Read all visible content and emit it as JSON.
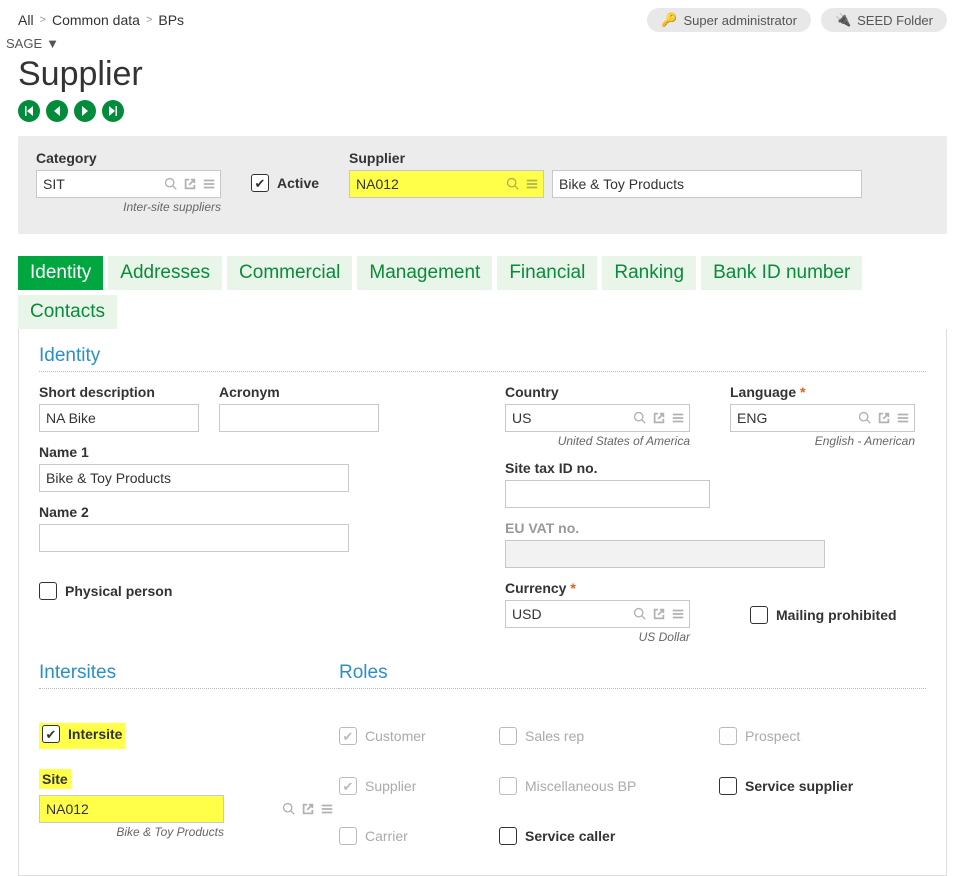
{
  "breadcrumb": {
    "all": "All",
    "common": "Common data",
    "bps": "BPs"
  },
  "topRight": {
    "superAdmin": "Super administrator",
    "seedFolder": "SEED Folder",
    "sage": "SAGE"
  },
  "pageTitle": "Supplier",
  "header": {
    "categoryLabel": "Category",
    "categoryValue": "SIT",
    "categoryHelper": "Inter-site suppliers",
    "activeLabel": "Active",
    "supplierLabel": "Supplier",
    "supplierCode": "NA012",
    "supplierName": "Bike & Toy Products"
  },
  "tabs": {
    "identity": "Identity",
    "addresses": "Addresses",
    "commercial": "Commercial",
    "management": "Management",
    "financial": "Financial",
    "ranking": "Ranking",
    "bankId": "Bank ID number",
    "contacts": "Contacts"
  },
  "identity": {
    "sectionTitle": "Identity",
    "shortDescLabel": "Short description",
    "shortDescValue": "NA Bike",
    "acronymLabel": "Acronym",
    "acronymValue": "",
    "name1Label": "Name 1",
    "name1Value": "Bike & Toy Products",
    "name2Label": "Name 2",
    "name2Value": "",
    "physicalPersonLabel": "Physical person",
    "countryLabel": "Country",
    "countryValue": "US",
    "countryHelper": "United States of America",
    "languageLabel": "Language",
    "languageValue": "ENG",
    "languageHelper": "English - American",
    "siteTaxLabel": "Site tax ID no.",
    "siteTaxValue": "",
    "euVatLabel": "EU VAT no.",
    "euVatValue": "",
    "currencyLabel": "Currency",
    "currencyValue": "USD",
    "currencyHelper": "US Dollar",
    "mailingProhibitedLabel": "Mailing prohibited"
  },
  "intersites": {
    "sectionTitle": "Intersites",
    "intersiteLabel": "Intersite",
    "siteLabel": "Site",
    "siteValue": "NA012",
    "siteHelper": "Bike & Toy Products"
  },
  "roles": {
    "sectionTitle": "Roles",
    "customer": "Customer",
    "salesRep": "Sales rep",
    "prospect": "Prospect",
    "supplier": "Supplier",
    "miscBP": "Miscellaneous BP",
    "serviceSupplier": "Service supplier",
    "carrier": "Carrier",
    "serviceCaller": "Service caller"
  }
}
